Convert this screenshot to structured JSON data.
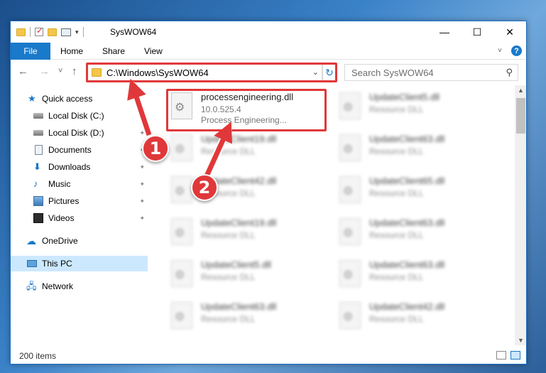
{
  "window": {
    "title": "SysWOW64"
  },
  "controls": {
    "minimize": "—",
    "maximize": "☐",
    "close": "✕"
  },
  "ribbon": {
    "file": "File",
    "home": "Home",
    "share": "Share",
    "view": "View",
    "help": "?"
  },
  "nav": {
    "back": "←",
    "forward": "→",
    "recent": "˅",
    "up": "↑",
    "address": "C:\\Windows\\SysWOW64",
    "search_placeholder": "Search SysWOW64"
  },
  "sidebar": {
    "items": [
      {
        "label": "Quick access"
      },
      {
        "label": "Local Disk (C:)"
      },
      {
        "label": "Local Disk (D:)"
      },
      {
        "label": "Documents"
      },
      {
        "label": "Downloads"
      },
      {
        "label": "Music"
      },
      {
        "label": "Pictures"
      },
      {
        "label": "Videos"
      },
      {
        "label": "OneDrive"
      },
      {
        "label": "This PC"
      },
      {
        "label": "Network"
      }
    ]
  },
  "files": {
    "main": {
      "name": "processengineering.dll",
      "version": "10.0.525.4",
      "description": "Process Engineering..."
    },
    "col1": [
      {
        "name": "UpdateClient19.dll",
        "desc": "Resource DLL"
      },
      {
        "name": "UpdateClient42.dll",
        "desc": "Resource DLL"
      },
      {
        "name": "UpdateClient19.dll",
        "desc": "Resource DLL"
      },
      {
        "name": "UpdateClient5.dll",
        "desc": "Resource DLL"
      },
      {
        "name": "UpdateClient63.dll",
        "desc": "Resource DLL"
      }
    ],
    "col2": [
      {
        "name": "UpdateClient5.dll",
        "desc": "Resource DLL"
      },
      {
        "name": "UpdateClient63.dll",
        "desc": "Resource DLL"
      },
      {
        "name": "UpdateClient65.dll",
        "desc": "Resource DLL"
      },
      {
        "name": "UpdateClient63.dll",
        "desc": "Resource DLL"
      },
      {
        "name": "UpdateClient63.dll",
        "desc": "Resource DLL"
      },
      {
        "name": "UpdateClient42.dll",
        "desc": "Resource DLL"
      }
    ]
  },
  "status": {
    "count": "200 items"
  },
  "callouts": {
    "one": "1",
    "two": "2"
  },
  "colors": {
    "accent": "#1979ca",
    "highlight": "#e0383a"
  }
}
